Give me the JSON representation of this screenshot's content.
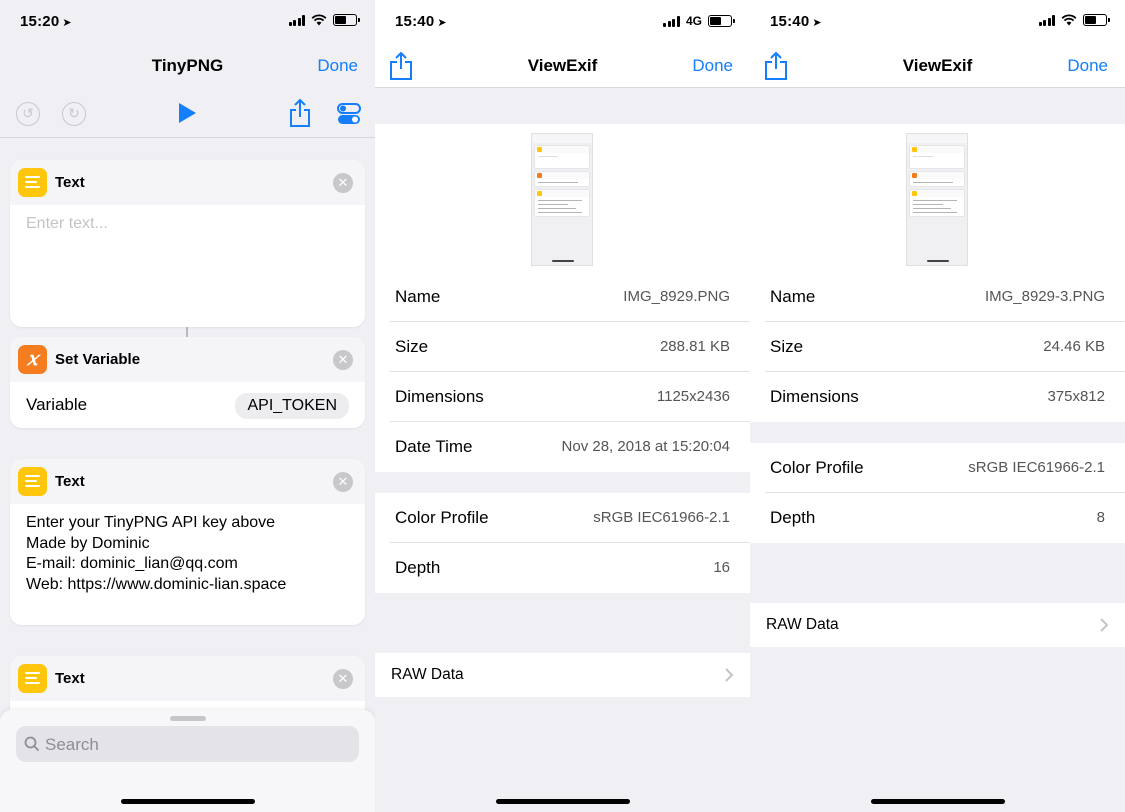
{
  "shortcut": {
    "status": {
      "time": "15:20"
    },
    "title": "TinyPNG",
    "done": "Done",
    "cards": [
      {
        "title": "Text",
        "placeholder": "Enter text..."
      },
      {
        "title": "Set Variable",
        "label": "Variable",
        "variable": "API_TOKEN"
      },
      {
        "title": "Text",
        "lines": [
          "Enter your TinyPNG API key above",
          "Made by Dominic",
          "E-mail: dominic_lian@qq.com",
          "Web: https://www.dominic-lian.space"
        ]
      },
      {
        "title": "Text"
      }
    ],
    "search_placeholder": "Search",
    "colors": {
      "accent": "#147efb",
      "text_icon": "#ffc60b",
      "variable_icon": "#f57c1f",
      "background": "#efeff4"
    }
  },
  "exif_left": {
    "status": {
      "time": "15:40",
      "network": "4G"
    },
    "title": "ViewExif",
    "done": "Done",
    "rows": [
      {
        "label": "Name",
        "value": "IMG_8929.PNG"
      },
      {
        "label": "Size",
        "value": "288.81 KB"
      },
      {
        "label": "Dimensions",
        "value": "1125x2436"
      },
      {
        "label": "Date Time",
        "value": "Nov 28, 2018 at 15:20:04"
      }
    ],
    "rows2": [
      {
        "label": "Color Profile",
        "value": "sRGB IEC61966-2.1"
      },
      {
        "label": "Depth",
        "value": "16"
      }
    ],
    "raw": "RAW Data"
  },
  "exif_right": {
    "status": {
      "time": "15:40"
    },
    "title": "ViewExif",
    "done": "Done",
    "rows": [
      {
        "label": "Name",
        "value": "IMG_8929-3.PNG"
      },
      {
        "label": "Size",
        "value": "24.46 KB"
      },
      {
        "label": "Dimensions",
        "value": "375x812"
      }
    ],
    "rows2": [
      {
        "label": "Color Profile",
        "value": "sRGB IEC61966-2.1"
      },
      {
        "label": "Depth",
        "value": "8"
      }
    ],
    "raw": "RAW Data"
  }
}
